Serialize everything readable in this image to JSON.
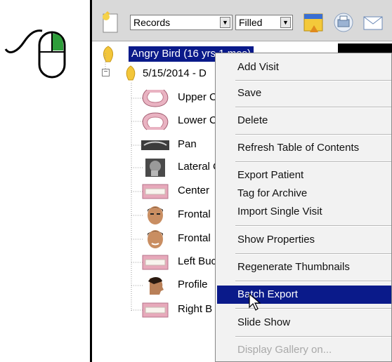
{
  "toolbar": {
    "records_select": "Records",
    "filter_select": "Filled",
    "icons": [
      "page-icon",
      "folder-icon",
      "print-icon",
      "mail-icon"
    ]
  },
  "tree": {
    "patient": "Angry Bird (16 yrs 1 mos)",
    "visit": "5/15/2014 - D",
    "items": [
      {
        "label": "Upper C",
        "icon": "upper-arch-icon"
      },
      {
        "label": "Lower C",
        "icon": "lower-arch-icon"
      },
      {
        "label": "Pan",
        "icon": "panoramic-xray-icon"
      },
      {
        "label": "Lateral C",
        "icon": "ceph-xray-icon"
      },
      {
        "label": "Center",
        "icon": "intraoral-teeth-icon"
      },
      {
        "label": "Frontal",
        "icon": "face-photo-icon"
      },
      {
        "label": "Frontal",
        "icon": "face-photo-icon"
      },
      {
        "label": "Left Buc",
        "icon": "intraoral-teeth-icon"
      },
      {
        "label": "Profile",
        "icon": "profile-photo-icon"
      },
      {
        "label": "Right B",
        "icon": "intraoral-teeth-icon"
      }
    ]
  },
  "context_menu": {
    "items": [
      {
        "label": "Add Visit",
        "state": "normal"
      },
      {
        "label": "Save",
        "state": "normal"
      },
      {
        "label": "Delete",
        "state": "normal"
      },
      {
        "label": "Refresh Table of Contents",
        "state": "normal"
      },
      {
        "label": "Export Patient",
        "state": "normal"
      },
      {
        "label": "Tag for Archive",
        "state": "normal"
      },
      {
        "label": "Import Single Visit",
        "state": "normal"
      },
      {
        "label": "Show Properties",
        "state": "normal"
      },
      {
        "label": "Regenerate Thumbnails",
        "state": "normal"
      },
      {
        "label": "Batch Export",
        "state": "highlighted"
      },
      {
        "label": "Slide Show",
        "state": "normal"
      },
      {
        "label": "Display Gallery on...",
        "state": "disabled"
      }
    ]
  },
  "colors": {
    "selection": "#0a1a8a",
    "menu_bg": "#f2f2f2",
    "mouse_button_active": "#2e9d3a"
  },
  "annotation": {
    "icon": "right-click-mouse-icon"
  }
}
